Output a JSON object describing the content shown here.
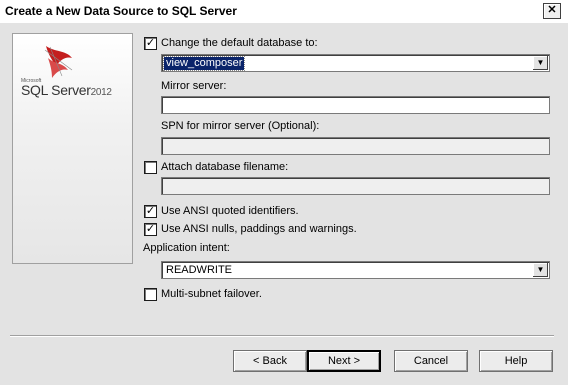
{
  "window": {
    "title": "Create a New Data Source to SQL Server",
    "close_glyph": "✕"
  },
  "logo": {
    "small": "Microsoft",
    "product": "SQL Server",
    "version": "2012"
  },
  "options": {
    "change_default_db": {
      "label": "Change the default database to:",
      "checked": true
    },
    "database_value": "view_composer",
    "mirror_server_label": "Mirror server:",
    "mirror_server_value": "",
    "spn_label": "SPN for mirror server (Optional):",
    "spn_value": "",
    "attach_db": {
      "label": "Attach database filename:",
      "checked": false
    },
    "attach_db_value": "",
    "ansi_quoted": {
      "label": "Use ANSI quoted identifiers.",
      "checked": true
    },
    "ansi_nulls": {
      "label": "Use ANSI nulls, paddings and warnings.",
      "checked": true
    },
    "app_intent_label": "Application intent:",
    "app_intent_value": "READWRITE",
    "multi_subnet": {
      "label": "Multi-subnet failover.",
      "checked": false
    }
  },
  "buttons": {
    "back": "< Back",
    "next": "Next >",
    "cancel": "Cancel",
    "help": "Help"
  },
  "check_glyph": "✓",
  "arrow_glyph": "▼"
}
